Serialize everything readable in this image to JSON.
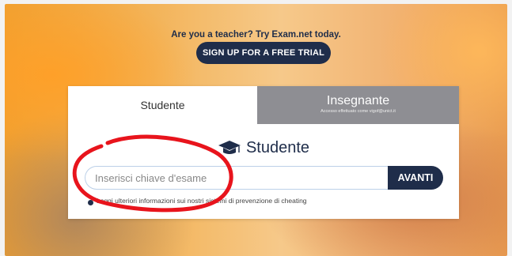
{
  "promo": {
    "text": "Are you a teacher? Try Exam.net today.",
    "button_label": "SIGN UP FOR A FREE TRIAL"
  },
  "tabs": [
    {
      "label": "Studente",
      "active": true
    },
    {
      "label": "Insegnante",
      "sublabel": "Accesso effettuato come vigof@unict.it",
      "active": false
    }
  ],
  "main": {
    "heading": "Studente",
    "heading_icon": "graduation-cap-icon",
    "input_placeholder": "Inserisci chiave d'esame",
    "input_value": "",
    "submit_label": "AVANTI",
    "info_link": "Leggi ulteriori informazioni sui nostri sistemi di prevenzione di cheating"
  },
  "colors": {
    "navy": "#1f2d4a",
    "tab_inactive": "#8e8e93",
    "annotation_red": "#e8141c"
  }
}
